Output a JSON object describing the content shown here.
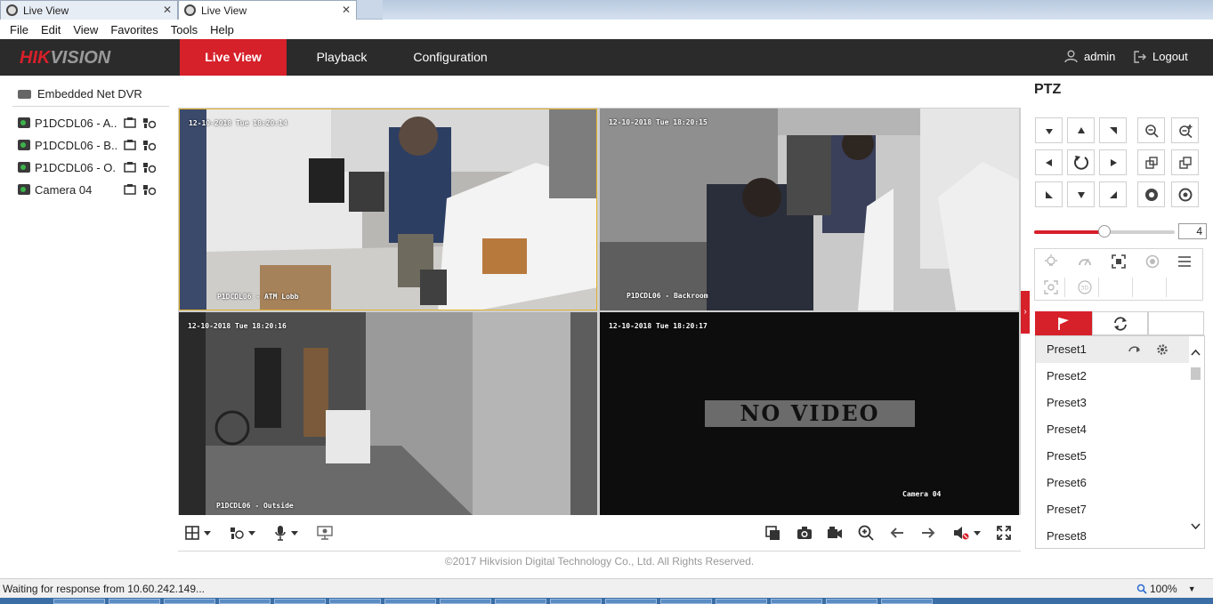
{
  "browser": {
    "tabs": [
      {
        "label": "Live View",
        "close": "✕",
        "active": false
      },
      {
        "label": "Live View",
        "close": "✕",
        "active": true
      }
    ],
    "menu": [
      "File",
      "Edit",
      "View",
      "Favorites",
      "Tools",
      "Help"
    ],
    "status": "Waiting for response from 10.60.242.149...",
    "zoom": "100%",
    "zoom_caret": "▼"
  },
  "app": {
    "brand_red": "#d6202a",
    "logo_hik": "HIK",
    "logo_vision": "VISION",
    "nav": [
      {
        "label": "Live View",
        "active": true
      },
      {
        "label": "Playback",
        "active": false
      },
      {
        "label": "Configuration",
        "active": false
      }
    ],
    "user": "admin",
    "logout": "Logout"
  },
  "tree": {
    "root": "Embedded Net DVR",
    "cameras": [
      {
        "label": "P1DCDL06 - A..."
      },
      {
        "label": "P1DCDL06 - B..."
      },
      {
        "label": "P1DCDL06 - O..."
      },
      {
        "label": "Camera 04"
      }
    ]
  },
  "video": {
    "cells": [
      {
        "time": "12-10-2018 Tue 18:20:14",
        "name": "P1DCDL06 - ATM Lobb",
        "selected": true
      },
      {
        "time": "12-10-2018 Tue 18:20:15",
        "name": "P1DCDL06 - Backroom",
        "selected": false
      },
      {
        "time": "12-10-2018 Tue 18:20:16",
        "name": "P1DCDL06 - Outside",
        "selected": false
      },
      {
        "time": "12-10-2018 Tue 18:20:17",
        "name": "Camera 04",
        "selected": false,
        "no_video": "NO VIDEO"
      }
    ]
  },
  "footer": {
    "copyright": "©2017 Hikvision Digital Technology Co., Ltd. All Rights Reserved."
  },
  "ptz": {
    "title": "PTZ",
    "speed": "4",
    "speed_level": 0.5,
    "presets": [
      "Preset1",
      "Preset2",
      "Preset3",
      "Preset4",
      "Preset5",
      "Preset6",
      "Preset7",
      "Preset8"
    ]
  }
}
